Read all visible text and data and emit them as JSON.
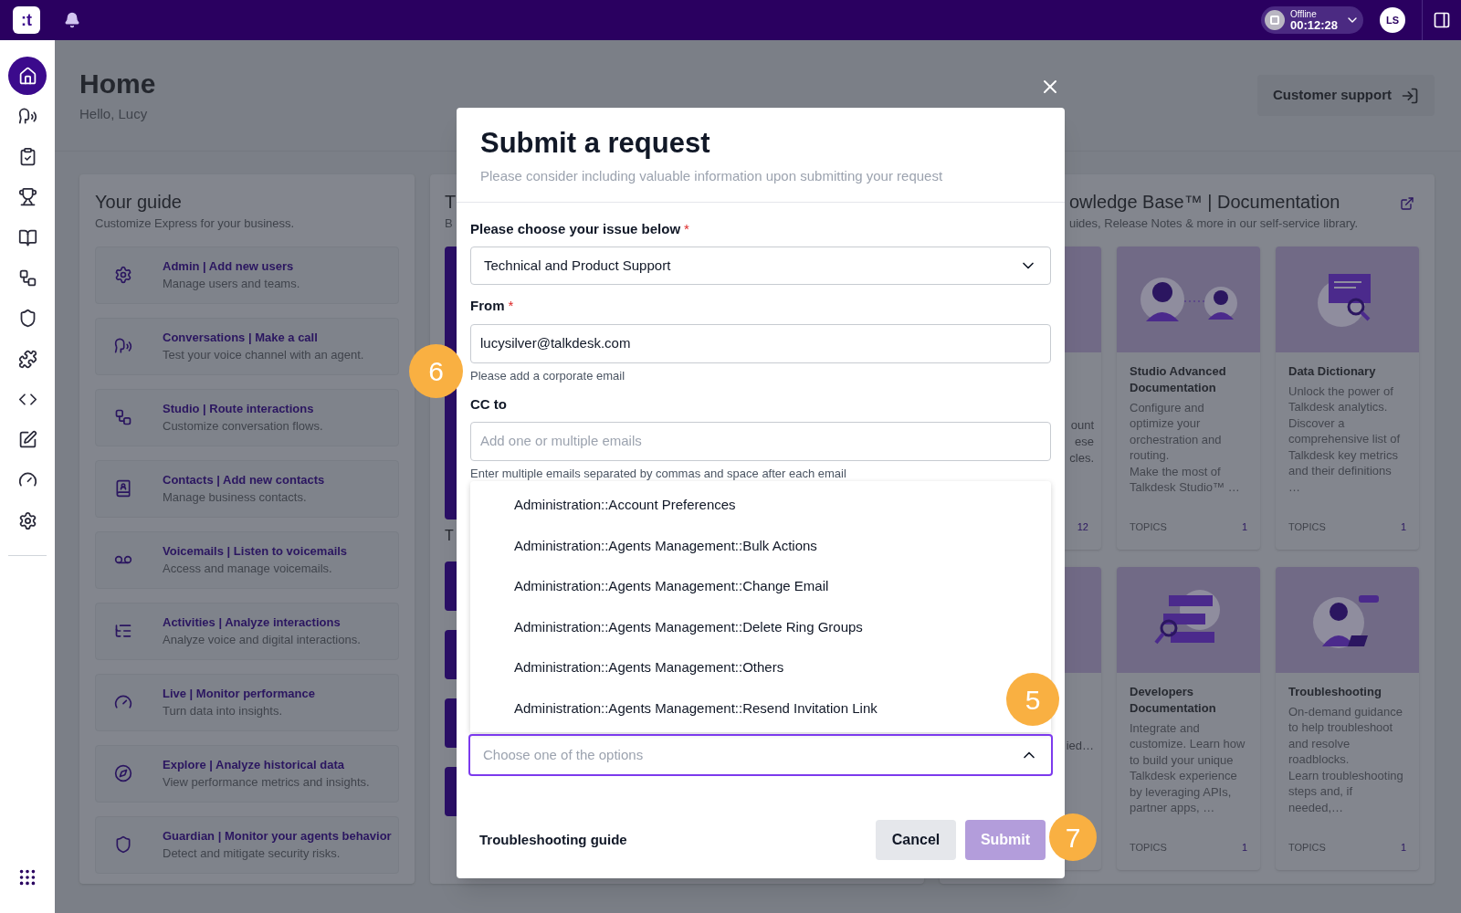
{
  "top_bar": {
    "logo": ":t",
    "status": {
      "label": "Offline",
      "timer": "00:12:28"
    },
    "avatar": "LS"
  },
  "sidebar": {
    "items": [
      {
        "selected": true
      },
      {
        "selected": false
      },
      {
        "selected": false
      },
      {
        "selected": false
      },
      {
        "selected": false
      },
      {
        "selected": false
      },
      {
        "selected": false
      },
      {
        "selected": false
      },
      {
        "selected": false
      },
      {
        "selected": false
      },
      {
        "selected": false
      },
      {
        "selected": false
      }
    ]
  },
  "header": {
    "title": "Home",
    "subtitle": "Hello, Lucy",
    "support_button": "Customer support"
  },
  "guide": {
    "title": "Your guide",
    "subtitle": "Customize Express for your business.",
    "items": [
      {
        "title": "Admin | Add new users",
        "description": "Manage users and teams."
      },
      {
        "title": "Conversations | Make a call",
        "description": "Test your voice channel with an agent."
      },
      {
        "title": "Studio | Route interactions",
        "description": "Customize conversation flows."
      },
      {
        "title": "Contacts | Add new contacts",
        "description": "Manage business contacts."
      },
      {
        "title": "Voicemails | Listen to voicemails",
        "description": "Access and manage voicemails."
      },
      {
        "title": "Activities | Analyze interactions",
        "description": "Analyze voice and digital interactions."
      },
      {
        "title": "Live | Monitor performance",
        "description": "Turn data into insights."
      },
      {
        "title": "Explore | Analyze historical data",
        "description": "View performance metrics and insights."
      },
      {
        "title": "Guardian | Monitor your agents behavior",
        "description": "Detect and mitigate security risks."
      }
    ]
  },
  "middle_panel": {
    "title": "T",
    "subtitle": "B",
    "section_title": "T"
  },
  "knowledge_base": {
    "title": "owledge Base™ | Documentation",
    "subtitle": "uides, Release Notes & more in our self-service library.",
    "cards": [
      {
        "kind": "partial",
        "lines": [
          "ount",
          "ese",
          "cles."
        ],
        "count": "12"
      },
      {
        "kind": "full",
        "title": "Studio Advanced Documentation",
        "description": [
          "Configure and optimize your orchestration and routing.",
          "Make the most of Talkdesk Studio™ …"
        ],
        "topics_label": "TOPICS",
        "count": "1"
      },
      {
        "kind": "full",
        "title": "Data Dictionary",
        "description": [
          "Unlock the power of Talkdesk analytics. Discover a comprehensive list of Talkdesk key metrics and their definitions …"
        ],
        "topics_label": "TOPICS",
        "count": "1"
      },
      {
        "kind": "partial",
        "lines": [
          "ied…"
        ]
      },
      {
        "kind": "full",
        "title": "Developers Documentation",
        "description": [
          "Integrate and customize. Learn how to build your unique Talkdesk experience by leveraging APIs, partner apps, …"
        ],
        "topics_label": "TOPICS",
        "count": "1"
      },
      {
        "kind": "full",
        "title": "Troubleshooting",
        "description": [
          "On-demand guidance to help troubleshoot and resolve roadblocks.",
          "Learn troubleshooting steps and, if needed,…"
        ],
        "topics_label": "TOPICS",
        "count": "1"
      }
    ]
  },
  "modal": {
    "title": "Submit a request",
    "subtitle": "Please consider including valuable information upon submitting your request",
    "fields": [
      {
        "kind": "select",
        "label": "Please choose your issue below",
        "required_mark": "*",
        "value": "Technical and Product Support",
        "expanded": false
      },
      {
        "kind": "input",
        "label": "From",
        "required_mark": "*",
        "value": "lucysilver@talkdesk.com",
        "helper": "Please add a corporate email"
      },
      {
        "kind": "input",
        "label": "CC to",
        "placeholder": "Add one or multiple emails",
        "helper": "Enter multiple emails separated by commas and space after each email"
      },
      {
        "kind": "select",
        "placeholder": "Choose one of the options",
        "expanded": true,
        "options": [
          {
            "label": "Administration::Account Preferences",
            "selected": false
          },
          {
            "label": "Administration::Agents Management::Bulk Actions",
            "selected": false
          },
          {
            "label": "Administration::Agents Management::Change Email",
            "selected": false
          },
          {
            "label": "Administration::Agents Management::Delete Ring Groups",
            "selected": false
          },
          {
            "label": "Administration::Agents Management::Others",
            "selected": false
          },
          {
            "label": "Administration::Agents Management::Resend Invitation Link",
            "selected": false
          }
        ]
      }
    ],
    "footer": {
      "link": "Troubleshooting guide",
      "cancel": "Cancel",
      "submit": {
        "label": "Submit",
        "disabled": true
      }
    }
  },
  "callouts": [
    {
      "number": "6"
    },
    {
      "number": "5"
    },
    {
      "number": "7"
    }
  ]
}
